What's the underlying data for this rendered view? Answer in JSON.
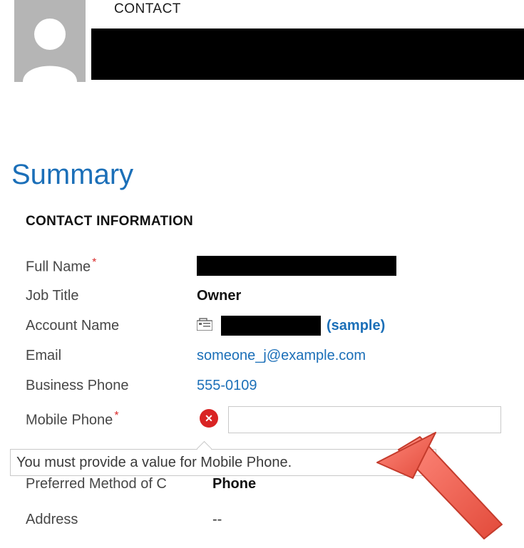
{
  "header": {
    "entity_label": "CONTACT"
  },
  "summary_heading": "Summary",
  "section_heading": "CONTACT INFORMATION",
  "fields": {
    "full_name": {
      "label": "Full Name",
      "required": true,
      "value_redacted": true
    },
    "job_title": {
      "label": "Job Title",
      "value": "Owner"
    },
    "account_name": {
      "label": "Account Name",
      "value_redacted": true,
      "suffix": "(sample)"
    },
    "email": {
      "label": "Email",
      "value": "someone_j@example.com"
    },
    "business_phone": {
      "label": "Business Phone",
      "value": "555-0109"
    },
    "mobile_phone": {
      "label": "Mobile Phone",
      "required": true,
      "value": ""
    },
    "preferred_method": {
      "label": "Preferred Method of C",
      "value": "Phone"
    },
    "address": {
      "label": "Address",
      "value": "--"
    }
  },
  "error_message": "You must provide a value for Mobile Phone."
}
